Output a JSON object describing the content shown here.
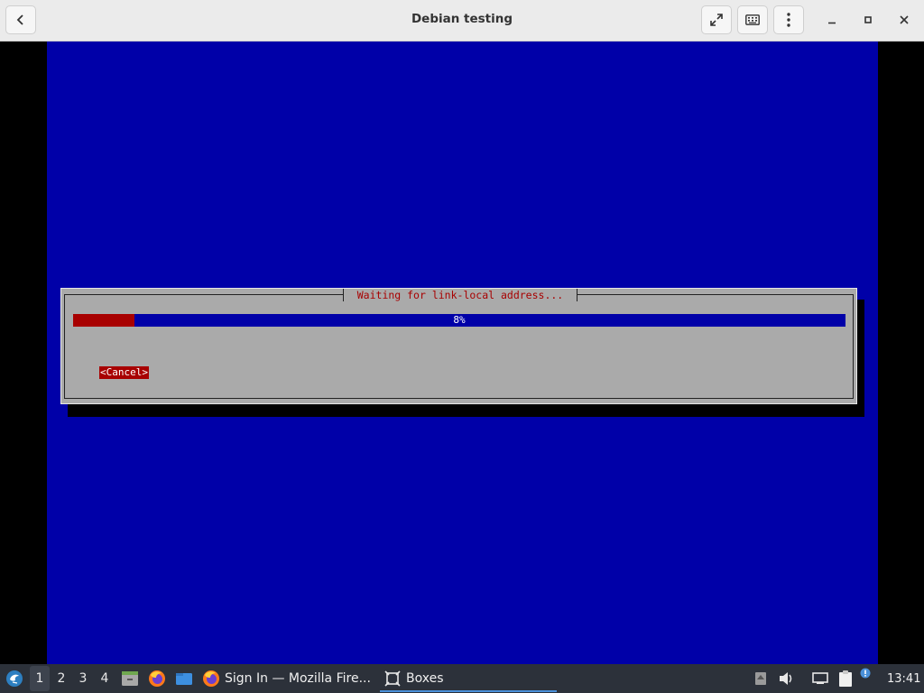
{
  "window": {
    "title": "Debian testing",
    "back_icon": "chevron-left-icon",
    "fullscreen_icon": "fullscreen-icon",
    "keyboard_icon": "keyboard-icon",
    "menu_icon": "vertical-ellipsis-icon",
    "minimize_icon": "minimize-icon",
    "maximize_icon": "maximize-icon",
    "close_icon": "close-icon"
  },
  "installer": {
    "dialog_title": "Waiting for link-local address...",
    "progress_percent": 8,
    "progress_label": "8%",
    "cancel_label": "<Cancel>",
    "colors": {
      "screen_bg": "#0000a8",
      "dialog_bg": "#aaaaaa",
      "accent_red": "#a80000"
    }
  },
  "taskbar": {
    "workspaces": [
      "1",
      "2",
      "3",
      "4"
    ],
    "active_workspace": "1",
    "launchers": [
      "start-menu-icon",
      "file-manager-icon",
      "firefox-icon",
      "folder-icon"
    ],
    "tasks": [
      {
        "label": "Sign In — Mozilla Fire...",
        "icon": "firefox-icon",
        "active": false
      },
      {
        "label": "Boxes",
        "icon": "boxes-icon",
        "active": true
      }
    ],
    "tray_icons": [
      "tray-arrow-icon",
      "volume-icon",
      "network-icon",
      "clipboard-icon",
      "notification-icon"
    ],
    "clock": "13:41"
  }
}
